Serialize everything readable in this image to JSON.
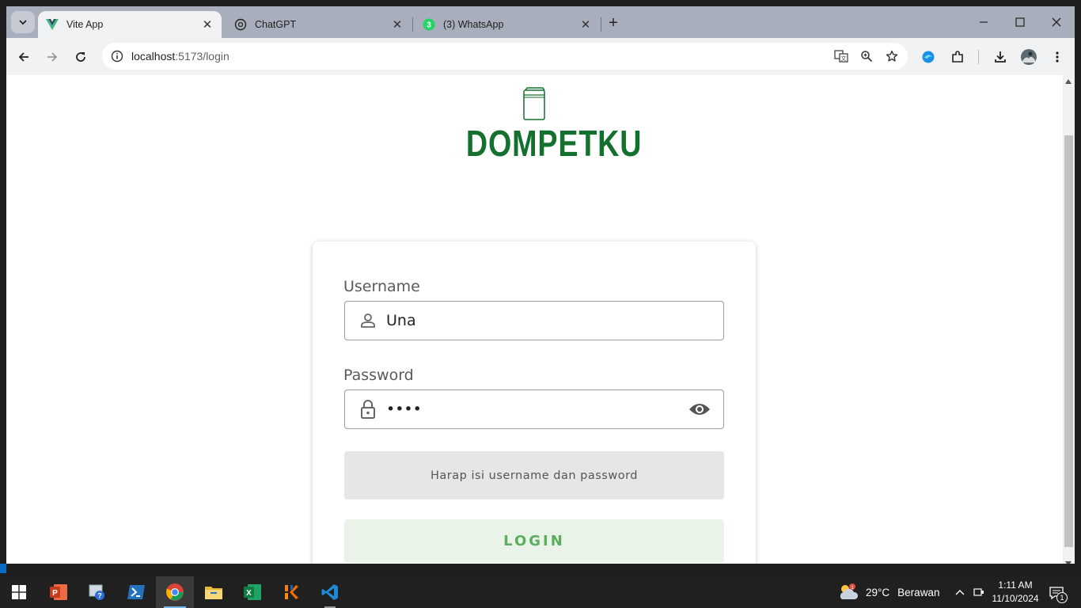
{
  "browser": {
    "tabs": [
      {
        "title": "Vite App",
        "active": true,
        "favicon": "vue-icon"
      },
      {
        "title": "ChatGPT",
        "active": false,
        "favicon": "chatgpt-icon"
      },
      {
        "title": "(3) WhatsApp",
        "active": false,
        "favicon": "whatsapp-icon",
        "badge": "3"
      }
    ],
    "url_host": "localhost",
    "url_path": ":5173/login"
  },
  "page": {
    "brand": "DOMPETKU",
    "username": {
      "label": "Username",
      "value": "Una"
    },
    "password": {
      "label": "Password",
      "value": "••••"
    },
    "alert": "Harap isi username dan password",
    "login_button": "LOGIN"
  },
  "taskbar": {
    "weather": {
      "temp": "29°C",
      "condition": "Berawan"
    },
    "time": "1:11 AM",
    "date": "11/10/2024",
    "notification_count": "1"
  },
  "colors": {
    "brand_green": "#14702e",
    "login_text": "#5bad5f",
    "login_bg": "#e9f3e8"
  }
}
